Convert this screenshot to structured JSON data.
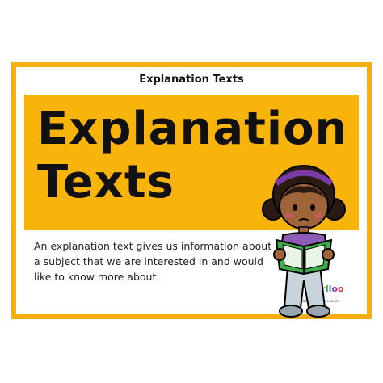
{
  "card": {
    "header_title": "Explanation Texts",
    "main_title_line1": "Explanation",
    "main_title_line2": "Texts",
    "description": "An explanation text gives us information about a subject that we are interested in and would like to know more about.",
    "brand": "mrlloo",
    "copyright": "©2017 www.mrlloo.co.uk"
  },
  "colors": {
    "frame": "#f5b010",
    "banner": "#f9b40c",
    "text": "#111111"
  },
  "illustration": {
    "icon": "girl-reading-book-icon"
  }
}
